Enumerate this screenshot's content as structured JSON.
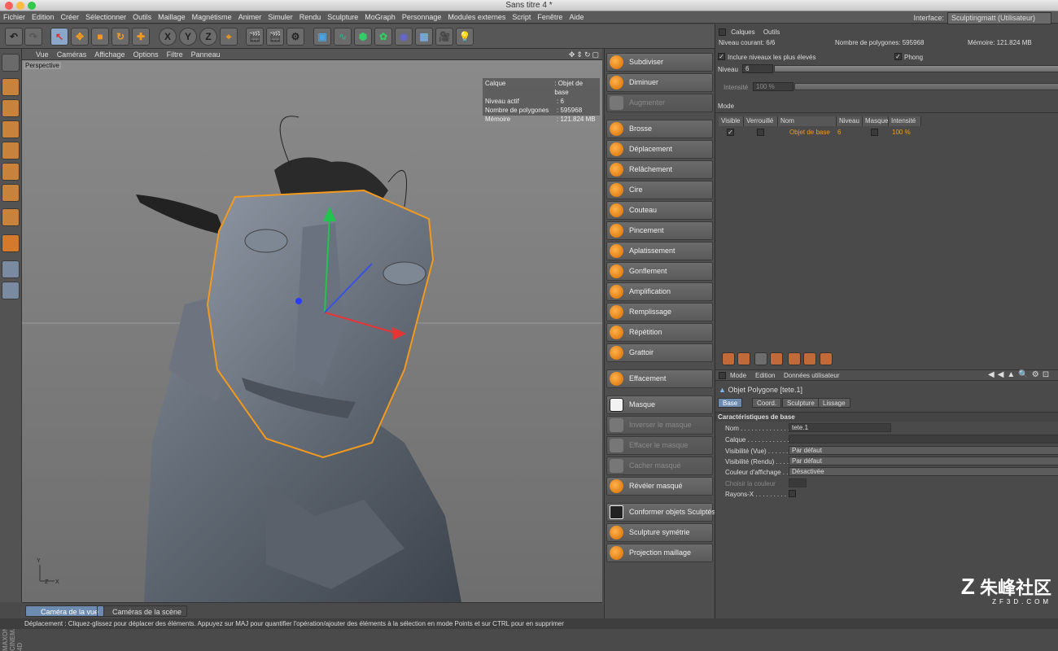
{
  "window": {
    "title": "Sans titre 4 *"
  },
  "menu": [
    "Fichier",
    "Edition",
    "Créer",
    "Sélectionner",
    "Outils",
    "Maillage",
    "Magnétisme",
    "Animer",
    "Simuler",
    "Rendu",
    "Sculpture",
    "MoGraph",
    "Personnage",
    "Modules externes",
    "Script",
    "Fenêtre",
    "Aide"
  ],
  "interface": {
    "label": "Interface:",
    "value": "Sculptingmatt (Utilisateur)"
  },
  "toolbar": {
    "x": "X",
    "y": "Y",
    "z": "Z"
  },
  "viewport": {
    "menu": [
      "Vue",
      "Caméras",
      "Affichage",
      "Options",
      "Filtre",
      "Panneau"
    ],
    "label": "Perspective",
    "hud": [
      [
        "Calque",
        ": Objet de base"
      ],
      [
        "Niveau actif",
        ": 6"
      ],
      [
        "Nombre de polygones",
        ": 595968"
      ],
      [
        "Mémoire",
        ": 121.824 MB"
      ]
    ],
    "axis": {
      "y": "Y",
      "x": "X",
      "z": "Z"
    }
  },
  "cameras": {
    "view": "Caméra de la vue",
    "scene": "Caméras de la scène"
  },
  "brand": "MAXON CINEMA 4D",
  "sculpt_tools": [
    {
      "label": "Subdiviser",
      "enabled": true
    },
    {
      "label": "Diminuer",
      "enabled": true
    },
    {
      "label": "Augmenter",
      "enabled": false
    },
    {
      "label": "Brosse",
      "enabled": true
    },
    {
      "label": "Déplacement",
      "enabled": true
    },
    {
      "label": "Relâchement",
      "enabled": true
    },
    {
      "label": "Cire",
      "enabled": true
    },
    {
      "label": "Couteau",
      "enabled": true
    },
    {
      "label": "Pincement",
      "enabled": true
    },
    {
      "label": "Aplatissement",
      "enabled": true
    },
    {
      "label": "Gonflement",
      "enabled": true
    },
    {
      "label": "Amplification",
      "enabled": true
    },
    {
      "label": "Remplissage",
      "enabled": true
    },
    {
      "label": "Répétition",
      "enabled": true
    },
    {
      "label": "Grattoir",
      "enabled": true
    },
    {
      "label": "Effacement",
      "enabled": true
    },
    {
      "label": "Masque",
      "enabled": true
    },
    {
      "label": "Inverser le masque",
      "enabled": false
    },
    {
      "label": "Effacer le masque",
      "enabled": false
    },
    {
      "label": "Cacher masqué",
      "enabled": false
    },
    {
      "label": "Révéler masqué",
      "enabled": true
    },
    {
      "label": "Conformer objets Sculptés",
      "enabled": true
    },
    {
      "label": "Sculpture symétrie",
      "enabled": true
    },
    {
      "label": "Projection maillage",
      "enabled": true
    }
  ],
  "layers": {
    "tabs": [
      "Calques",
      "Outils"
    ],
    "current_level": "Niveau courant: 6/6",
    "polygons": "Nombre de polygones: 595968",
    "memory": "Mémoire: 121.824 MB",
    "include_higher": "Inclure niveaux les plus élevés",
    "phong": "Phong",
    "level_label": "Niveau",
    "level_value": "6",
    "intensity_label": "Intensité",
    "intensity_value": "100 %",
    "mode": "Mode",
    "columns": [
      "Visible",
      "Verrouillé",
      "Nom",
      "Niveau",
      "Masque",
      "Intensité"
    ],
    "row": {
      "name": "Objet de base",
      "level": "6",
      "intensity": "100 %"
    }
  },
  "attributes": {
    "menu": [
      "Mode",
      "Edition",
      "Données utilisateur"
    ],
    "object": "Objet Polygone [tete.1]",
    "tabs": [
      "Base",
      "Coord.",
      "Sculpture",
      "Lissage"
    ],
    "section": "Caractéristiques de base",
    "fields": [
      {
        "label": "Nom . . . . . . . . . . . . . .",
        "value": "tete.1"
      },
      {
        "label": "Calque . . . . . . . . . . . . .",
        "value": ""
      },
      {
        "label": "Visibilité (Vue) . . . . . . .",
        "value": "Par défaut"
      },
      {
        "label": "Visibilité (Rendu) . . . . .",
        "value": "Par défaut"
      },
      {
        "label": "Couleur d'affichage . . . .",
        "value": "Désactivée"
      },
      {
        "label": "Choisir la couleur",
        "value": ""
      },
      {
        "label": "Rayons-X . . . . . . . . . . .",
        "value": ""
      }
    ]
  },
  "status": "Déplacement : Cliquez-glissez pour déplacer des éléments. Appuyez sur MAJ pour quantifier l'opération/ajouter des éléments à la sélection en mode Points et sur CTRL pour en supprimer",
  "watermark": {
    "text": "朱峰社区",
    "url": "ZF3D.COM"
  },
  "colors": {
    "accent": "#f39a1e",
    "selection": "#6d8ab0",
    "status_ok": "#3bd35a"
  }
}
